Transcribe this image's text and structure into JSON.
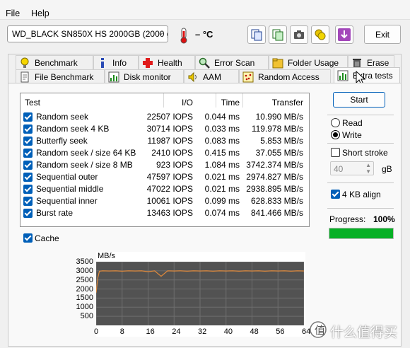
{
  "menu": {
    "file": "File",
    "help": "Help"
  },
  "toolbar": {
    "drive": "WD_BLACK SN850X HS 2000GB (2000 g",
    "temperature": "– °C",
    "exit_label": "Exit"
  },
  "tabs": {
    "row1": [
      "Benchmark",
      "Info",
      "Health",
      "Error Scan",
      "Folder Usage",
      "Erase"
    ],
    "row2": [
      "File Benchmark",
      "Disk monitor",
      "AAM",
      "Random Access",
      "Extra tests"
    ]
  },
  "table": {
    "headers": {
      "test": "Test",
      "io": "I/O",
      "time": "Time",
      "transfer": "Transfer"
    },
    "rows": [
      {
        "test": "Random seek",
        "io": "22507 IOPS",
        "time": "0.044 ms",
        "transfer": "10.990 MB/s"
      },
      {
        "test": "Random seek 4 KB",
        "io": "30714 IOPS",
        "time": "0.033 ms",
        "transfer": "119.978 MB/s"
      },
      {
        "test": "Butterfly seek",
        "io": "11987 IOPS",
        "time": "0.083 ms",
        "transfer": "5.853 MB/s"
      },
      {
        "test": "Random seek / size 64 KB",
        "io": "2410 IOPS",
        "time": "0.415 ms",
        "transfer": "37.055 MB/s"
      },
      {
        "test": "Random seek / size 8 MB",
        "io": "923 IOPS",
        "time": "1.084 ms",
        "transfer": "3742.374 MB/s"
      },
      {
        "test": "Sequential outer",
        "io": "47597 IOPS",
        "time": "0.021 ms",
        "transfer": "2974.827 MB/s"
      },
      {
        "test": "Sequential middle",
        "io": "47022 IOPS",
        "time": "0.021 ms",
        "transfer": "2938.895 MB/s"
      },
      {
        "test": "Sequential inner",
        "io": "10061 IOPS",
        "time": "0.099 ms",
        "transfer": "628.833 MB/s"
      },
      {
        "test": "Burst rate",
        "io": "13463 IOPS",
        "time": "0.074 ms",
        "transfer": "841.466 MB/s"
      }
    ]
  },
  "side": {
    "start": "Start",
    "read": "Read",
    "write": "Write",
    "mode": "write",
    "short_stroke": "Short stroke",
    "size_value": "40",
    "size_unit": "gB",
    "align": "4 KB align",
    "progress_label": "Progress:",
    "progress_value": "100%",
    "progress": 1.0
  },
  "cache_label": "Cache",
  "watermark": "什么值得买",
  "colors": {
    "accent": "#005fb8",
    "progress": "#06b025",
    "plot_bg": "#525252",
    "series": "#e08a3c"
  },
  "chart_data": {
    "type": "line",
    "ylabel": "MB/s",
    "y_ticks": [
      3500,
      3000,
      2500,
      2000,
      1500,
      1000,
      500
    ],
    "x_ticks": [
      0,
      8,
      16,
      24,
      32,
      40,
      48,
      56,
      64
    ],
    "xlim": [
      0,
      64
    ],
    "ylim": [
      0,
      3500
    ],
    "series": [
      {
        "x": [
          0,
          0.5,
          1,
          2,
          4,
          6,
          8,
          10,
          12,
          14,
          16,
          18,
          20,
          22,
          24,
          26,
          28,
          30,
          32,
          34,
          36,
          38,
          40,
          42,
          44,
          46,
          48,
          50,
          52,
          54,
          56,
          58,
          60,
          62,
          64
        ],
        "y": [
          1800,
          2600,
          2980,
          3000,
          2990,
          3000,
          2980,
          3000,
          2990,
          3000,
          2950,
          3000,
          2700,
          3000,
          2990,
          3000,
          2980,
          3000,
          2990,
          3000,
          2980,
          3000,
          2990,
          3000,
          2980,
          3000,
          2990,
          3000,
          2980,
          3000,
          2990,
          3000,
          2980,
          3000,
          2990
        ]
      }
    ]
  }
}
